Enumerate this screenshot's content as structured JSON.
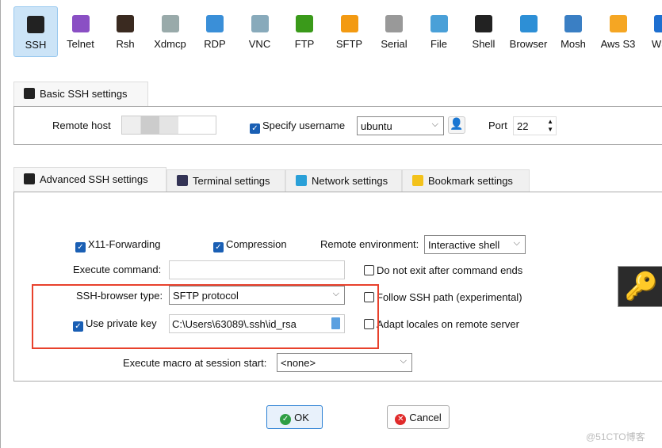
{
  "toolbar": [
    {
      "label": "SSH",
      "icon": "ssh-key-icon",
      "color": "#222"
    },
    {
      "label": "Telnet",
      "icon": "telnet-icon",
      "color": "#8a4fc4"
    },
    {
      "label": "Rsh",
      "icon": "rsh-icon",
      "color": "#3a2a20"
    },
    {
      "label": "Xdmcp",
      "icon": "xdmcp-icon",
      "color": "#9aa"
    },
    {
      "label": "RDP",
      "icon": "rdp-icon",
      "color": "#3a8fd8"
    },
    {
      "label": "VNC",
      "icon": "vnc-icon",
      "color": "#8ab"
    },
    {
      "label": "FTP",
      "icon": "ftp-globe-icon",
      "color": "#3a9a1a"
    },
    {
      "label": "SFTP",
      "icon": "sftp-globe-icon",
      "color": "#f39a12"
    },
    {
      "label": "Serial",
      "icon": "serial-plug-icon",
      "color": "#999"
    },
    {
      "label": "File",
      "icon": "file-monitor-icon",
      "color": "#4aa0d8"
    },
    {
      "label": "Shell",
      "icon": "shell-terminal-icon",
      "color": "#222"
    },
    {
      "label": "Browser",
      "icon": "browser-globe-icon",
      "color": "#2d8fd6"
    },
    {
      "label": "Mosh",
      "icon": "mosh-satellite-icon",
      "color": "#3a7fc4"
    },
    {
      "label": "Aws S3",
      "icon": "aws-s3-icon",
      "color": "#f5a623"
    },
    {
      "label": "WSL",
      "icon": "wsl-icon",
      "color": "#1e6fd0"
    }
  ],
  "basic": {
    "tab": "Basic SSH settings",
    "remote_host_label": "Remote host",
    "remote_host_value": "",
    "specify_username_label": "Specify username",
    "specify_username_checked": true,
    "username": "ubuntu",
    "port_label": "Port",
    "port": "22"
  },
  "tabs": [
    "Advanced SSH settings",
    "Terminal settings",
    "Network settings",
    "Bookmark settings"
  ],
  "advanced": {
    "x11_label": "X11-Forwarding",
    "x11_checked": true,
    "compression_label": "Compression",
    "compression_checked": true,
    "remote_env_label": "Remote environment:",
    "remote_env_value": "Interactive shell",
    "exec_cmd_label": "Execute command:",
    "exec_cmd_value": "",
    "no_exit_label": "Do not exit after command ends",
    "no_exit_checked": false,
    "browser_type_label": "SSH-browser type:",
    "browser_type_value": "SFTP protocol",
    "follow_label": "Follow SSH path (experimental)",
    "follow_checked": false,
    "private_key_label": "Use private key",
    "private_key_checked": true,
    "private_key_value": "C:\\Users\\63089\\.ssh\\id_rsa",
    "locales_label": "Adapt locales on remote server",
    "locales_checked": false,
    "macro_label": "Execute macro at session start:",
    "macro_value": "<none>"
  },
  "buttons": {
    "ok": "OK",
    "cancel": "Cancel"
  },
  "watermark": "@51CTO博客",
  "highlight_color": "#e8412c"
}
